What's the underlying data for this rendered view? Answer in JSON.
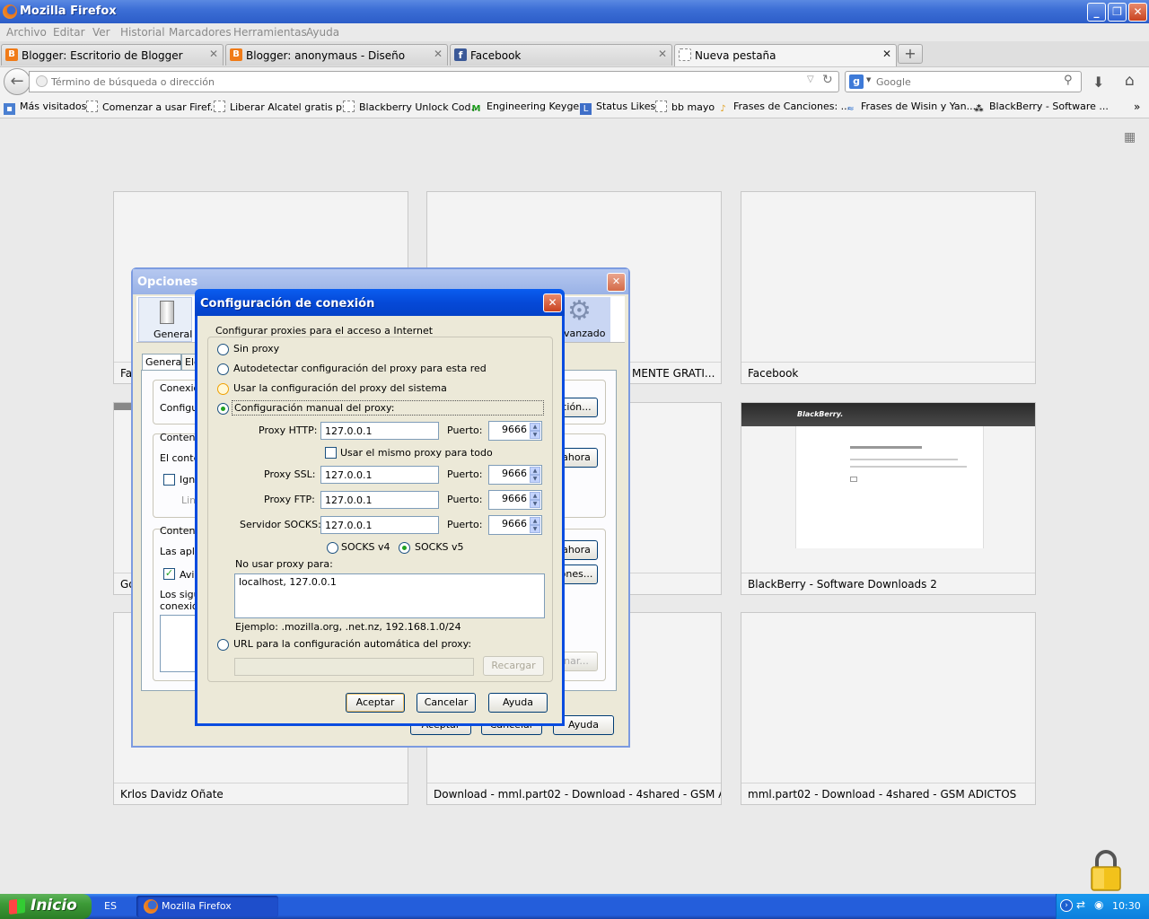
{
  "window": {
    "title": "Mozilla Firefox"
  },
  "menu": [
    "Archivo",
    "Editar",
    "Ver",
    "Historial",
    "Marcadores",
    "Herramientas",
    "Ayuda"
  ],
  "tabs": [
    {
      "label": "Blogger: Escritorio de Blogger",
      "icon": "blogger-icon"
    },
    {
      "label": "Blogger: anonymaus - Diseño",
      "icon": "blogger-icon"
    },
    {
      "label": "Facebook",
      "icon": "facebook-icon"
    },
    {
      "label": "Nueva pestaña",
      "icon": "blank-page-icon",
      "active": true
    }
  ],
  "nav": {
    "url_placeholder": "Término de búsqueda o dirección",
    "search_placeholder": "Google"
  },
  "bookmarks": [
    "Más visitados",
    "Comenzar a usar Firef...",
    "Liberar Alcatel gratis p...",
    "Blackberry Unlock Cod...",
    "Engineering Keygen",
    "Status Likes",
    "bb mayo",
    "Frases de Canciones: ...",
    "Frases de Wisin y Yan...",
    "BlackBerry - Software ..."
  ],
  "thumbnails": {
    "t1": "Fa",
    "t2": "MENTE GRATI...",
    "t3": "Facebook",
    "t4": "Go",
    "t6": "BlackBerry - Software Downloads 2",
    "t7": "Krlos Davidz Oñate",
    "t8": "Download - mml.part02 - Download - 4shared - GSM A...",
    "t9": "mml.part02 - Download - 4shared - GSM ADICTOS",
    "bb_brand": "BlackBerry."
  },
  "opciones": {
    "title": "Opciones",
    "general": "General",
    "avanzado": "vanzado",
    "tab_general": "General",
    "tab_ele": "Ele",
    "conexion": "Conexió",
    "configur": "Configur",
    "config_btn": "ción...",
    "contenido1": "Contenid",
    "el_conte": "El conte",
    "ahora1": "ahora",
    "igno": "Igno",
    "limi": "Lim",
    "contenido2": "Conteni",
    "las_aplic": "Las aplic",
    "ahora2": "ahora",
    "ones": "ones...",
    "avis": "Avis",
    "los_sigu": "Los sigu",
    "conexion2": "conexió",
    "nar": "nar...",
    "aceptar": "Aceptar",
    "cancelar": "Cancelar",
    "ayuda": "Ayuda"
  },
  "config": {
    "title": "Configuración de conexión",
    "group_label": "Configurar proxies para el acceso a Internet",
    "opt_none": "Sin proxy",
    "opt_auto": "Autodetectar configuración del proxy para esta red",
    "opt_system": "Usar la configuración del proxy del sistema",
    "opt_manual": "Configuración manual del proxy:",
    "http_label": "Proxy HTTP:",
    "http_value": "127.0.0.1",
    "http_port": "9666",
    "port_label": "Puerto:",
    "same_proxy": "Usar el mismo proxy para todo",
    "ssl_label": "Proxy SSL:",
    "ssl_value": "127.0.0.1",
    "ssl_port": "9666",
    "ftp_label": "Proxy FTP:",
    "ftp_value": "127.0.0.1",
    "ftp_port": "9666",
    "socks_label": "Servidor SOCKS:",
    "socks_value": "127.0.0.1",
    "socks_port": "9666",
    "socks4": "SOCKS v4",
    "socks5": "SOCKS v5",
    "no_proxy_label": "No usar proxy para:",
    "no_proxy_value": "localhost, 127.0.0.1",
    "example": "Ejemplo: .mozilla.org, .net.nz, 192.168.1.0/24",
    "opt_url": "URL para la configuración automática del proxy:",
    "reload": "Recargar",
    "ok": "Aceptar",
    "cancel": "Cancelar",
    "help": "Ayuda"
  },
  "taskbar": {
    "start": "Inicio",
    "lang": "ES",
    "task": "Mozilla Firefox",
    "clock": "10:30"
  }
}
